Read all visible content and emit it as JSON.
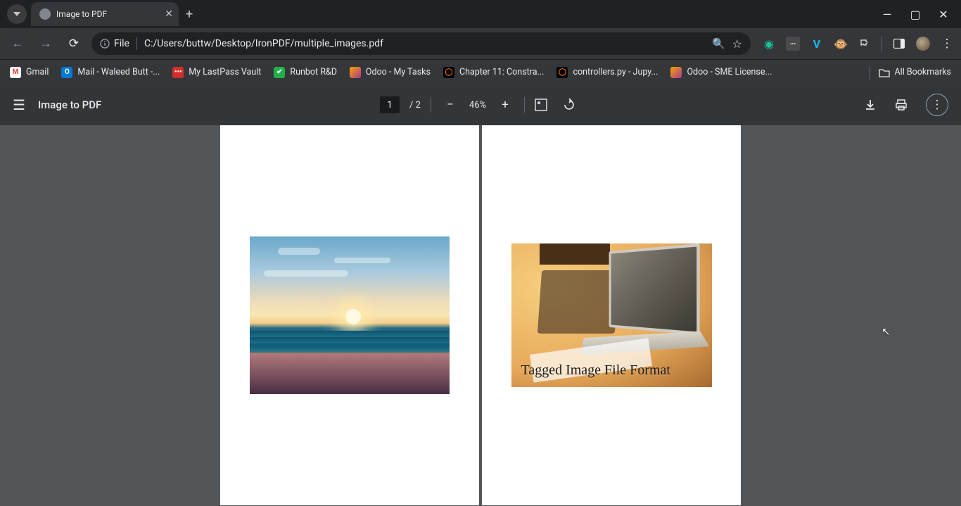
{
  "window": {
    "tab_title": "Image to PDF"
  },
  "address": {
    "scheme_label": "File",
    "path": "C:/Users/buttw/Desktop/IronPDF/multiple_images.pdf"
  },
  "bookmarks": [
    {
      "label": "Gmail",
      "icon_bg": "#fff",
      "icon_text": "M",
      "icon_color": "#ea4335"
    },
    {
      "label": "Mail - Waleed Butt -...",
      "icon_bg": "#0078d4",
      "icon_text": "O",
      "icon_color": "#fff"
    },
    {
      "label": "My LastPass Vault",
      "icon_bg": "#d32d27",
      "icon_text": "•••",
      "icon_color": "#fff"
    },
    {
      "label": "Runbot R&D",
      "icon_bg": "#21b04b",
      "icon_text": "✔",
      "icon_color": "#fff"
    },
    {
      "label": "Odoo - My Tasks",
      "icon_bg": "linear-gradient(135deg,#f7a300,#aa3a8e)",
      "icon_text": "",
      "icon_color": "#fff"
    },
    {
      "label": "Chapter 11: Constra...",
      "icon_bg": "#000",
      "icon_text": "◯",
      "icon_color": "#f37021"
    },
    {
      "label": "controllers.py - Jupy...",
      "icon_bg": "#000",
      "icon_text": "◯",
      "icon_color": "#f37021"
    },
    {
      "label": "Odoo - SME License...",
      "icon_bg": "linear-gradient(135deg,#f7a300,#aa3a8e)",
      "icon_text": "",
      "icon_color": "#fff"
    }
  ],
  "bookmarks_all": "All Bookmarks",
  "pdf": {
    "title": "Image to PDF",
    "current_page": "1",
    "total_pages": "2",
    "page_sep": "/",
    "zoom": "46%",
    "page2_caption": "Tagged Image File Format"
  },
  "ext_icons": [
    "grammarly-icon",
    "lastpass-icon",
    "vimeo-icon",
    "monkey-icon",
    "extensions-icon"
  ],
  "colors": {
    "chrome_dark": "#202124",
    "toolbar": "#35363a",
    "pdf_toolbar": "#323639",
    "viewer_bg": "#525659"
  }
}
